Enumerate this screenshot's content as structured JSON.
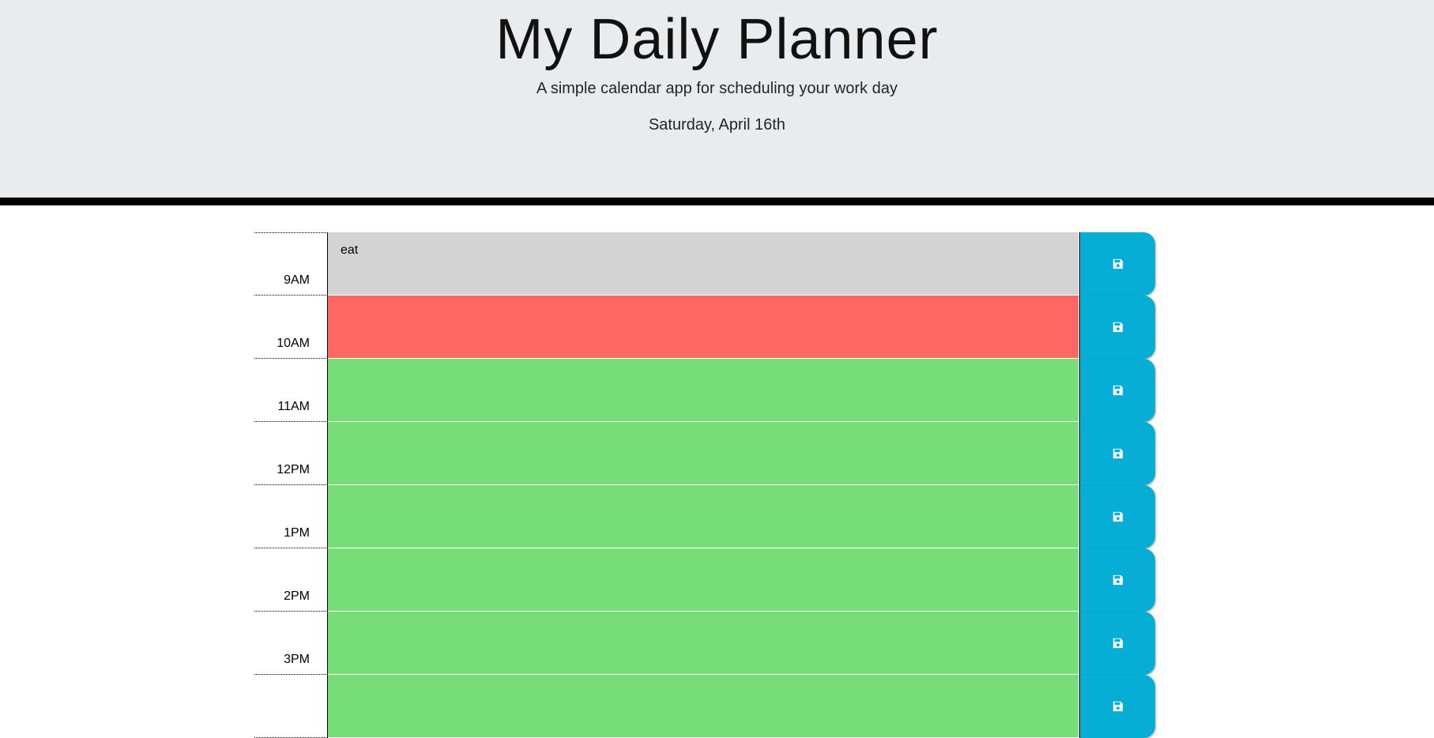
{
  "header": {
    "title": "My Daily Planner",
    "subtitle": "A simple calendar app for scheduling your work day",
    "current_day": "Saturday, April 16th"
  },
  "colors": {
    "past": "#d3d3d3",
    "present": "#ff6961",
    "future": "#77dd77",
    "save_button": "#06aed5",
    "header_background": "#e9ecef"
  },
  "time_blocks": [
    {
      "hour": "9AM",
      "text": "eat",
      "state": "past",
      "icon": "save-icon"
    },
    {
      "hour": "10AM",
      "text": "",
      "state": "present",
      "icon": "save-icon"
    },
    {
      "hour": "11AM",
      "text": "",
      "state": "future",
      "icon": "save-icon"
    },
    {
      "hour": "12PM",
      "text": "",
      "state": "future",
      "icon": "save-icon"
    },
    {
      "hour": "1PM",
      "text": "",
      "state": "future",
      "icon": "save-icon"
    },
    {
      "hour": "2PM",
      "text": "",
      "state": "future",
      "icon": "save-icon"
    },
    {
      "hour": "3PM",
      "text": "",
      "state": "future",
      "icon": "save-icon"
    },
    {
      "hour": "",
      "text": "",
      "state": "future",
      "icon": "save-icon"
    }
  ]
}
